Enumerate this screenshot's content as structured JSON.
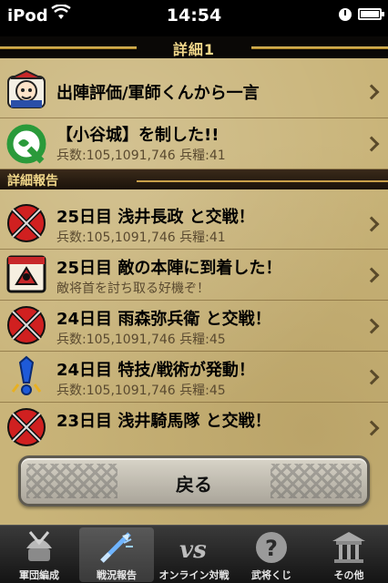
{
  "status_bar": {
    "carrier": "iPod",
    "time": "14:54"
  },
  "header": {
    "title": "詳細1"
  },
  "summary_rows": [
    {
      "title": "出陣評価/軍師くんから一言",
      "icon": "advisor-icon"
    },
    {
      "title": "【小谷城】を制した!!",
      "subtitle": "兵数:105,1091,746 兵糧:41",
      "icon": "green-q-icon"
    }
  ],
  "section": {
    "label": "詳細報告"
  },
  "report_rows": [
    {
      "title": "25日目 浅井長政 と交戦！",
      "subtitle": "兵数:105,1091,746 兵糧:41",
      "icon": "crossed-swords-icon"
    },
    {
      "title": "25日目 敵の本陣に到着した！",
      "subtitle": "敵将首を討ち取る好機ぞ！",
      "icon": "enemy-camp-icon"
    },
    {
      "title": "24日目 雨森弥兵衛 と交戦！",
      "subtitle": "兵数:105,1091,746 兵糧:45",
      "icon": "crossed-swords-icon"
    },
    {
      "title": "24日目 特技/戦術が発動！",
      "subtitle": "兵数:105,1091,746 兵糧:45",
      "icon": "exclamation-icon"
    },
    {
      "title": "23日目 浅井騎馬隊 と交戦！",
      "icon": "crossed-swords-icon"
    }
  ],
  "back_button": {
    "label": "戻る"
  },
  "tabs": [
    {
      "label": "軍団編成",
      "icon": "samurai-helmet-icon",
      "active": false
    },
    {
      "label": "戦況報告",
      "icon": "sword-icon",
      "active": true
    },
    {
      "label": "オンライン対戦",
      "icon": "vs-icon",
      "active": false
    },
    {
      "label": "武将くじ",
      "icon": "question-mark-icon",
      "active": false
    },
    {
      "label": "その他",
      "icon": "shrine-icon",
      "active": false
    }
  ],
  "colors": {
    "parchment": "#c9b479",
    "gold": "#f2d88a",
    "header_bg": "#0a0806"
  }
}
